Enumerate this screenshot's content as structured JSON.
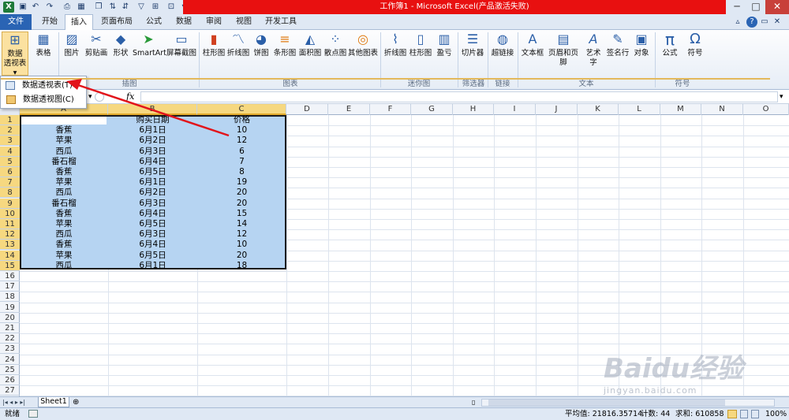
{
  "window": {
    "title": "工作簿1 - Microsoft Excel(产品激活失败)",
    "min": "─",
    "max": "□",
    "close": "✕"
  },
  "tabs": [
    "文件",
    "开始",
    "插入",
    "页面布局",
    "公式",
    "数据",
    "审阅",
    "视图",
    "开发工具"
  ],
  "ribbon": {
    "tables": {
      "pivot": "数据\n透视表",
      "table": "表格",
      "group": ""
    },
    "illustrations": {
      "items": [
        "图片",
        "剪贴画",
        "形状",
        "SmartArt",
        "屏幕截图"
      ],
      "group": "插图"
    },
    "charts": {
      "items": [
        "柱形图",
        "折线图",
        "饼图",
        "条形图",
        "面积图",
        "散点图",
        "其他图表"
      ],
      "group": "图表"
    },
    "sparklines": {
      "items": [
        "折线图",
        "柱形图",
        "盈亏"
      ],
      "group": "迷你图"
    },
    "filter": {
      "items": [
        "切片器"
      ],
      "group": "筛选器"
    },
    "links": {
      "items": [
        "超链接"
      ],
      "group": "链接"
    },
    "text": {
      "items": [
        "文本框",
        "页眉和页脚",
        "艺术字",
        "签名行",
        "对象"
      ],
      "group": "文本"
    },
    "symbols": {
      "items": [
        "公式",
        "符号"
      ],
      "group": "符号"
    }
  },
  "dropdown": {
    "item1": "数据透视表(T)",
    "item2": "数据透视图(C)"
  },
  "formulabar": {
    "fx": "fx"
  },
  "columns": [
    "A",
    "B",
    "C",
    "D",
    "E",
    "F",
    "G",
    "H",
    "I",
    "J",
    "K",
    "L",
    "M",
    "N",
    "O"
  ],
  "rows": [
    "1",
    "2",
    "3",
    "4",
    "5",
    "6",
    "7",
    "8",
    "9",
    "10",
    "11",
    "12",
    "13",
    "14",
    "15",
    "16",
    "17",
    "18",
    "19",
    "20",
    "21",
    "22",
    "23",
    "24",
    "25",
    "26",
    "27"
  ],
  "table": {
    "header": [
      "",
      "购买日期",
      "价格"
    ],
    "rows": [
      [
        "香蕉",
        "6月1日",
        "10"
      ],
      [
        "苹果",
        "6月2日",
        "12"
      ],
      [
        "西瓜",
        "6月3日",
        "6"
      ],
      [
        "番石榴",
        "6月4日",
        "7"
      ],
      [
        "香蕉",
        "6月5日",
        "8"
      ],
      [
        "苹果",
        "6月1日",
        "19"
      ],
      [
        "西瓜",
        "6月2日",
        "20"
      ],
      [
        "番石榴",
        "6月3日",
        "20"
      ],
      [
        "香蕉",
        "6月4日",
        "15"
      ],
      [
        "苹果",
        "6月5日",
        "14"
      ],
      [
        "西瓜",
        "6月3日",
        "12"
      ],
      [
        "香蕉",
        "6月4日",
        "10"
      ],
      [
        "苹果",
        "6月5日",
        "20"
      ],
      [
        "西瓜",
        "6月1日",
        "18"
      ]
    ]
  },
  "sheet": {
    "name": "Sheet1"
  },
  "status": {
    "ready": "就绪",
    "average": "平均值: 21816.35714",
    "count": "计数: 44",
    "sum": "求和: 610858",
    "zoom": "100%"
  },
  "watermark": {
    "brand": "Baidu经验",
    "url": "jingyan.baidu.com"
  }
}
